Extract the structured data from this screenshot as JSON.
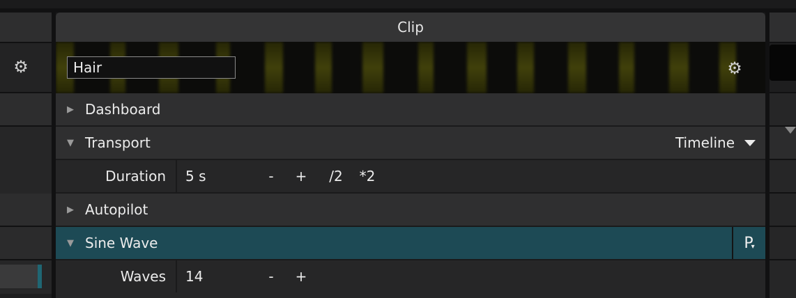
{
  "clip_panel": {
    "title": "Clip",
    "clip_name": "Hair",
    "thumbnail_color": "#4a4a0c"
  },
  "sections": {
    "dashboard": {
      "label": "Dashboard",
      "expanded": false
    },
    "transport": {
      "label": "Transport",
      "expanded": true,
      "mode": "Timeline",
      "duration": {
        "label": "Duration",
        "value": "5 s",
        "minus": "-",
        "plus": "+",
        "half": "/2",
        "double": "*2"
      }
    },
    "autopilot": {
      "label": "Autopilot",
      "expanded": false
    },
    "sine_wave": {
      "label": "Sine Wave",
      "expanded": true,
      "preset_button": "P",
      "accent_color": "#1d4a55",
      "waves": {
        "label": "Waves",
        "value": "14",
        "minus": "-",
        "plus": "+"
      }
    }
  },
  "icons": {
    "gear": "⚙",
    "collapsed": "▶",
    "expanded": "▼"
  }
}
